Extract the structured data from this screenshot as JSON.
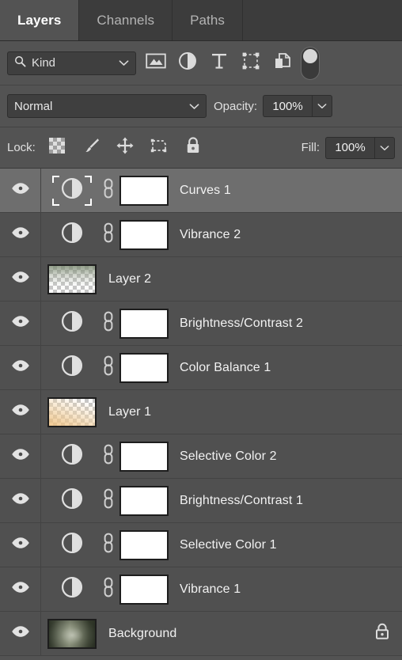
{
  "tabs": [
    {
      "label": "Layers",
      "active": true
    },
    {
      "label": "Channels",
      "active": false
    },
    {
      "label": "Paths",
      "active": false
    }
  ],
  "filter": {
    "kind_label": "Kind",
    "search_icon": "search-icon",
    "chevron_icon": "chevron-down-icon",
    "type_filters": [
      {
        "name": "filter-pixel-layers",
        "icon": "image-icon"
      },
      {
        "name": "filter-adjustment-layers",
        "icon": "adjustment-half-circle-icon"
      },
      {
        "name": "filter-type-layers",
        "icon": "text-type-icon"
      },
      {
        "name": "filter-shape-layers",
        "icon": "shape-bounding-box-icon"
      },
      {
        "name": "filter-smart-objects",
        "icon": "smart-object-document-icon"
      }
    ],
    "toggle_name": "filter-enable-toggle",
    "toggle_on": true
  },
  "blend": {
    "mode": "Normal",
    "opacity_label": "Opacity:",
    "opacity_value": "100%",
    "fill_label": "Fill:",
    "fill_value": "100%"
  },
  "lock": {
    "label": "Lock:",
    "items": [
      {
        "name": "lock-transparent-pixels",
        "icon": "checkerboard-icon"
      },
      {
        "name": "lock-image-pixels",
        "icon": "brush-icon"
      },
      {
        "name": "lock-position",
        "icon": "move-arrows-icon"
      },
      {
        "name": "lock-artboard-nesting",
        "icon": "artboard-icon"
      },
      {
        "name": "lock-all",
        "icon": "padlock-icon"
      }
    ]
  },
  "colors": {
    "panel_bg": "#535353",
    "row_bg": "#505050",
    "row_selected_bg": "#6e6e6e",
    "tab_inactive_bg": "#3c3c3c",
    "field_bg": "#3f3f3f",
    "text": "#f2f2f2"
  },
  "layers": [
    {
      "name": "Curves 1",
      "type": "adjustment",
      "selected": true,
      "visible": true,
      "has_mask": true,
      "linked": true,
      "locked": false
    },
    {
      "name": "Vibrance 2",
      "type": "adjustment",
      "selected": false,
      "visible": true,
      "has_mask": true,
      "linked": true,
      "locked": false
    },
    {
      "name": "Layer 2",
      "type": "pixel",
      "selected": false,
      "visible": true,
      "has_mask": false,
      "linked": false,
      "locked": false,
      "thumb_tint": "green"
    },
    {
      "name": "Brightness/Contrast 2",
      "type": "adjustment",
      "selected": false,
      "visible": true,
      "has_mask": true,
      "linked": true,
      "locked": false
    },
    {
      "name": "Color Balance 1",
      "type": "adjustment",
      "selected": false,
      "visible": true,
      "has_mask": true,
      "linked": true,
      "locked": false
    },
    {
      "name": "Layer 1",
      "type": "pixel",
      "selected": false,
      "visible": true,
      "has_mask": false,
      "linked": false,
      "locked": false,
      "thumb_tint": "orange"
    },
    {
      "name": "Selective Color 2",
      "type": "adjustment",
      "selected": false,
      "visible": true,
      "has_mask": true,
      "linked": true,
      "locked": false
    },
    {
      "name": "Brightness/Contrast 1",
      "type": "adjustment",
      "selected": false,
      "visible": true,
      "has_mask": true,
      "linked": true,
      "locked": false
    },
    {
      "name": "Selective Color 1",
      "type": "adjustment",
      "selected": false,
      "visible": true,
      "has_mask": true,
      "linked": true,
      "locked": false
    },
    {
      "name": "Vibrance 1",
      "type": "adjustment",
      "selected": false,
      "visible": true,
      "has_mask": true,
      "linked": true,
      "locked": false
    },
    {
      "name": "Background",
      "type": "photo",
      "selected": false,
      "visible": true,
      "has_mask": false,
      "linked": false,
      "locked": true
    }
  ]
}
